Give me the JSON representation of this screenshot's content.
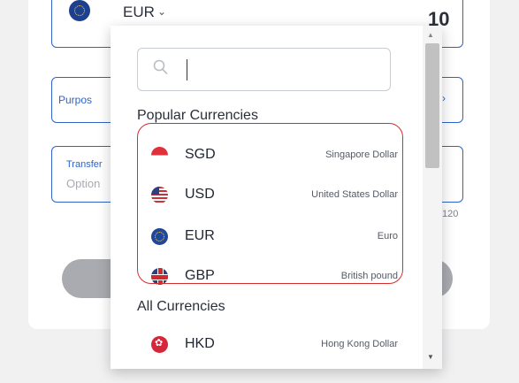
{
  "background": {
    "from_currency_code": "EUR",
    "amount_partial": "10",
    "purpose_label": "Purpos",
    "transfer_label": "Transfer",
    "transfer_placeholder": "Option",
    "char_count_partial": "120"
  },
  "dropdown": {
    "search_placeholder": "",
    "popular_title": "Popular Currencies",
    "popular": [
      {
        "code": "SGD",
        "name": "Singapore Dollar",
        "flag": "sg-flag-icon"
      },
      {
        "code": "USD",
        "name": "United States Dollar",
        "flag": "us-flag-icon"
      },
      {
        "code": "EUR",
        "name": "Euro",
        "flag": "eu-flag-icon"
      },
      {
        "code": "GBP",
        "name": "British pound",
        "flag": "gb-flag-icon"
      }
    ],
    "all_title": "All Currencies",
    "all": [
      {
        "code": "HKD",
        "name": "Hong Kong Dollar",
        "flag": "hk-flag-icon"
      }
    ]
  },
  "colors": {
    "accent": "#2f63c9",
    "highlight": "#d62e2e"
  }
}
